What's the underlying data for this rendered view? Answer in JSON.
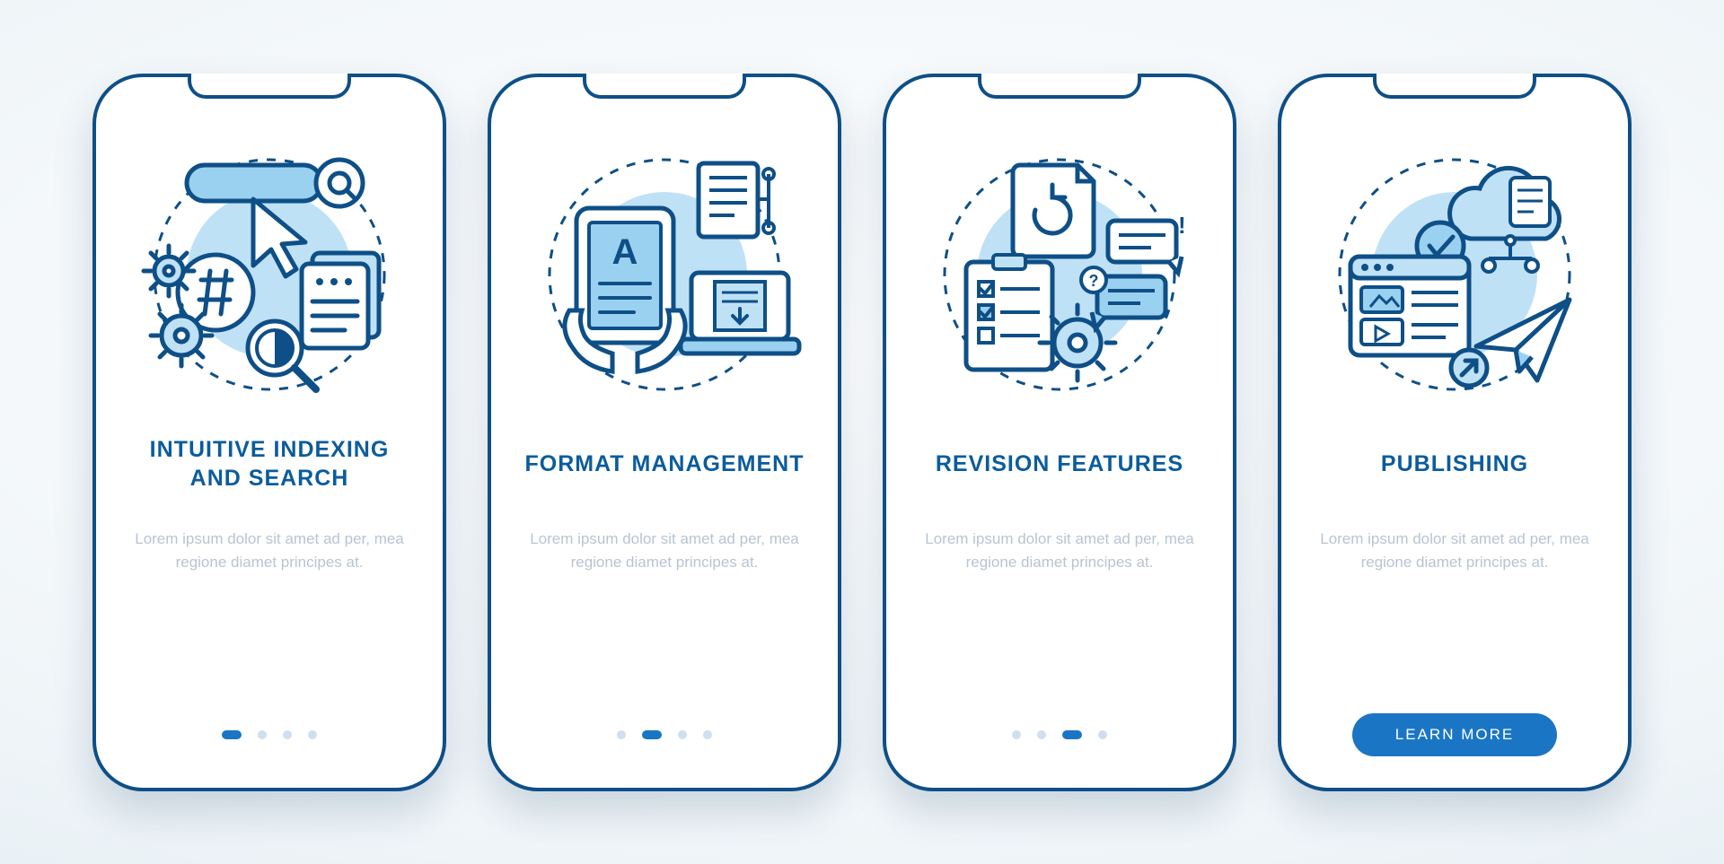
{
  "colors": {
    "stroke": "#0e4f87",
    "fillLight": "#bfe1f6",
    "fillMed": "#9bd1f0",
    "accent": "#1a76c4",
    "dotInactive": "#cfdfee"
  },
  "screens": [
    {
      "title": "INTUITIVE INDEXING AND SEARCH",
      "description": "Lorem ipsum dolor sit amet ad per, mea regione diamet principes at.",
      "activeIndex": 0,
      "cta": null,
      "iconName": "indexing-search-illustration"
    },
    {
      "title": "FORMAT MANAGEMENT",
      "description": "Lorem ipsum dolor sit amet ad per, mea regione diamet principes at.",
      "activeIndex": 1,
      "cta": null,
      "iconName": "format-management-illustration"
    },
    {
      "title": "REVISION FEATURES",
      "description": "Lorem ipsum dolor sit amet ad per, mea regione diamet principes at.",
      "activeIndex": 2,
      "cta": null,
      "iconName": "revision-features-illustration"
    },
    {
      "title": "PUBLISHING",
      "description": "Lorem ipsum dolor sit amet ad per, mea regione diamet principes at.",
      "activeIndex": 3,
      "cta": "LEARN MORE",
      "iconName": "publishing-illustration"
    }
  ],
  "dotCount": 4
}
